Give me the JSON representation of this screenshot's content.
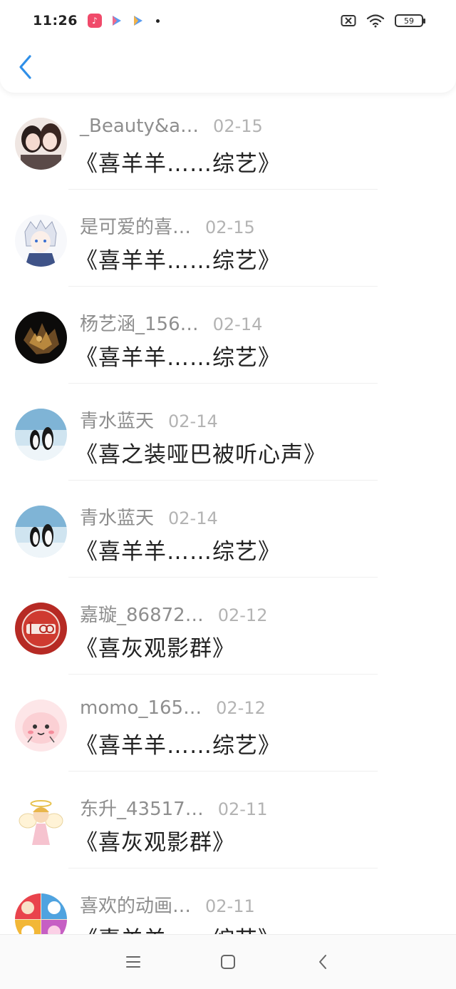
{
  "status_bar": {
    "time": "11:26",
    "battery": "59",
    "notification_icons": [
      "douyin-icon",
      "video-play-icon",
      "video-play-icon"
    ]
  },
  "header": {
    "back_icon": "chevron-left-icon"
  },
  "conversations": [
    {
      "name": "_Beauty&a…",
      "date": "02-15",
      "message": "《喜羊羊……综艺》",
      "avatar": "photo-girls"
    },
    {
      "name": "是可爱的喜…",
      "date": "02-15",
      "message": "《喜羊羊……综艺》",
      "avatar": "anime-character"
    },
    {
      "name": "杨艺涵_156…",
      "date": "02-14",
      "message": "《喜羊羊……综艺》",
      "avatar": "dark-abstract"
    },
    {
      "name": "青水蓝天",
      "date": "02-14",
      "message": "《喜之装哑巴被听心声》",
      "avatar": "penguins"
    },
    {
      "name": "青水蓝天",
      "date": "02-14",
      "message": "《喜羊羊……综艺》",
      "avatar": "penguins"
    },
    {
      "name": "嘉璇_86872…",
      "date": "02-12",
      "message": "《喜灰观影群》",
      "avatar": "red-badge"
    },
    {
      "name": "momo_165…",
      "date": "02-12",
      "message": "《喜羊羊……综艺》",
      "avatar": "pink-blob"
    },
    {
      "name": "东升_43517…",
      "date": "02-11",
      "message": "《喜灰观影群》",
      "avatar": "angel-figure"
    },
    {
      "name": "喜欢的动画…",
      "date": "02-11",
      "message": "《喜羊羊……综艺》",
      "avatar": "cartoon-collage"
    }
  ],
  "nav_bar": {
    "icons": [
      "menu-icon",
      "home-square-icon",
      "back-triangle-icon"
    ]
  },
  "colors": {
    "accent": "#2f8fe8",
    "name_text": "#8e8e8e",
    "date_text": "#b3b3b3",
    "message_text": "#222222"
  }
}
